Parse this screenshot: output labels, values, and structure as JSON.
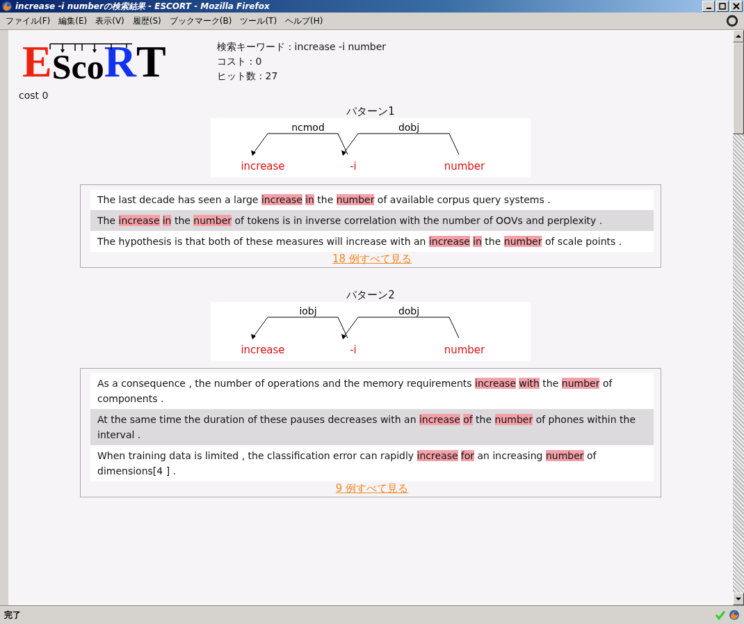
{
  "window": {
    "title": "increase -i numberの検索結果 - ESCORT - Mozilla Firefox"
  },
  "menu": [
    "ファイル(F)",
    "編集(E)",
    "表示(V)",
    "履歴(S)",
    "ブックマーク(B)",
    "ツール(T)",
    "ヘルプ(H)"
  ],
  "logo": [
    {
      "letter": "E",
      "color": "#ee2211",
      "kind": "large"
    },
    {
      "letter": "S",
      "color": "#000000",
      "kind": "small"
    },
    {
      "letter": "c",
      "color": "#000000",
      "kind": "small"
    },
    {
      "letter": "o",
      "color": "#000000",
      "kind": "small"
    },
    {
      "letter": "R",
      "color": "#1133ee",
      "kind": "large"
    },
    {
      "letter": "T",
      "color": "#000000",
      "kind": "large"
    }
  ],
  "summary": [
    "検索キーワード : increase -i number",
    "コスト : 0",
    "ヒット数 : 27"
  ],
  "cost_label": "cost 0",
  "patterns": [
    {
      "title": "パターン1",
      "words": [
        "increase",
        "-i",
        "number"
      ],
      "arcs": [
        {
          "label": "ncmod"
        },
        {
          "label": "dobj"
        }
      ],
      "sentences": [
        [
          {
            "text": "The last decade has seen a large ",
            "hit": false
          },
          {
            "text": "increase",
            "hit": true
          },
          {
            "text": "in",
            "hit": true
          },
          {
            "text": " the ",
            "hit": false
          },
          {
            "text": "number",
            "hit": true
          },
          {
            "text": " of available corpus query systems .",
            "hit": false
          }
        ],
        [
          {
            "text": "The ",
            "hit": false
          },
          {
            "text": "increase",
            "hit": true
          },
          {
            "text": "in",
            "hit": true
          },
          {
            "text": " the ",
            "hit": false
          },
          {
            "text": "number",
            "hit": true
          },
          {
            "text": " of tokens is in inverse correlation with the number of OOVs and perplexity .",
            "hit": false
          }
        ],
        [
          {
            "text": "The hypothesis is that both of these measures will increase with an ",
            "hit": false
          },
          {
            "text": "increase",
            "hit": true
          },
          {
            "text": "in",
            "hit": true
          },
          {
            "text": " the ",
            "hit": false
          },
          {
            "text": "number",
            "hit": true
          },
          {
            "text": " of scale points .",
            "hit": false
          }
        ]
      ],
      "link": "18 例すべて見る"
    },
    {
      "title": "パターン2",
      "words": [
        "increase",
        "-i",
        "number"
      ],
      "arcs": [
        {
          "label": "iobj"
        },
        {
          "label": "dobj"
        }
      ],
      "sentences": [
        [
          {
            "text": "As a consequence , the number of operations and the memory requirements ",
            "hit": false
          },
          {
            "text": "increase",
            "hit": true
          },
          {
            "text": "with",
            "hit": true
          },
          {
            "text": " the ",
            "hit": false
          },
          {
            "text": "number",
            "hit": true
          },
          {
            "text": " of components .",
            "hit": false
          }
        ],
        [
          {
            "text": "At the same time the duration of these pauses decreases with an ",
            "hit": false
          },
          {
            "text": "increase",
            "hit": true
          },
          {
            "text": "of",
            "hit": true
          },
          {
            "text": " the ",
            "hit": false
          },
          {
            "text": "number",
            "hit": true
          },
          {
            "text": " of phones within the interval .",
            "hit": false
          }
        ],
        [
          {
            "text": "When training data is limited , the classification error can rapidly ",
            "hit": false
          },
          {
            "text": "increase",
            "hit": true
          },
          {
            "text": "for",
            "hit": true
          },
          {
            "text": " an increasing ",
            "hit": false
          },
          {
            "text": "number",
            "hit": true
          },
          {
            "text": " of dimensions[4 ] .",
            "hit": false
          }
        ]
      ],
      "link": "9 例すべて見る"
    }
  ],
  "status_bar": {
    "text": "完了"
  }
}
